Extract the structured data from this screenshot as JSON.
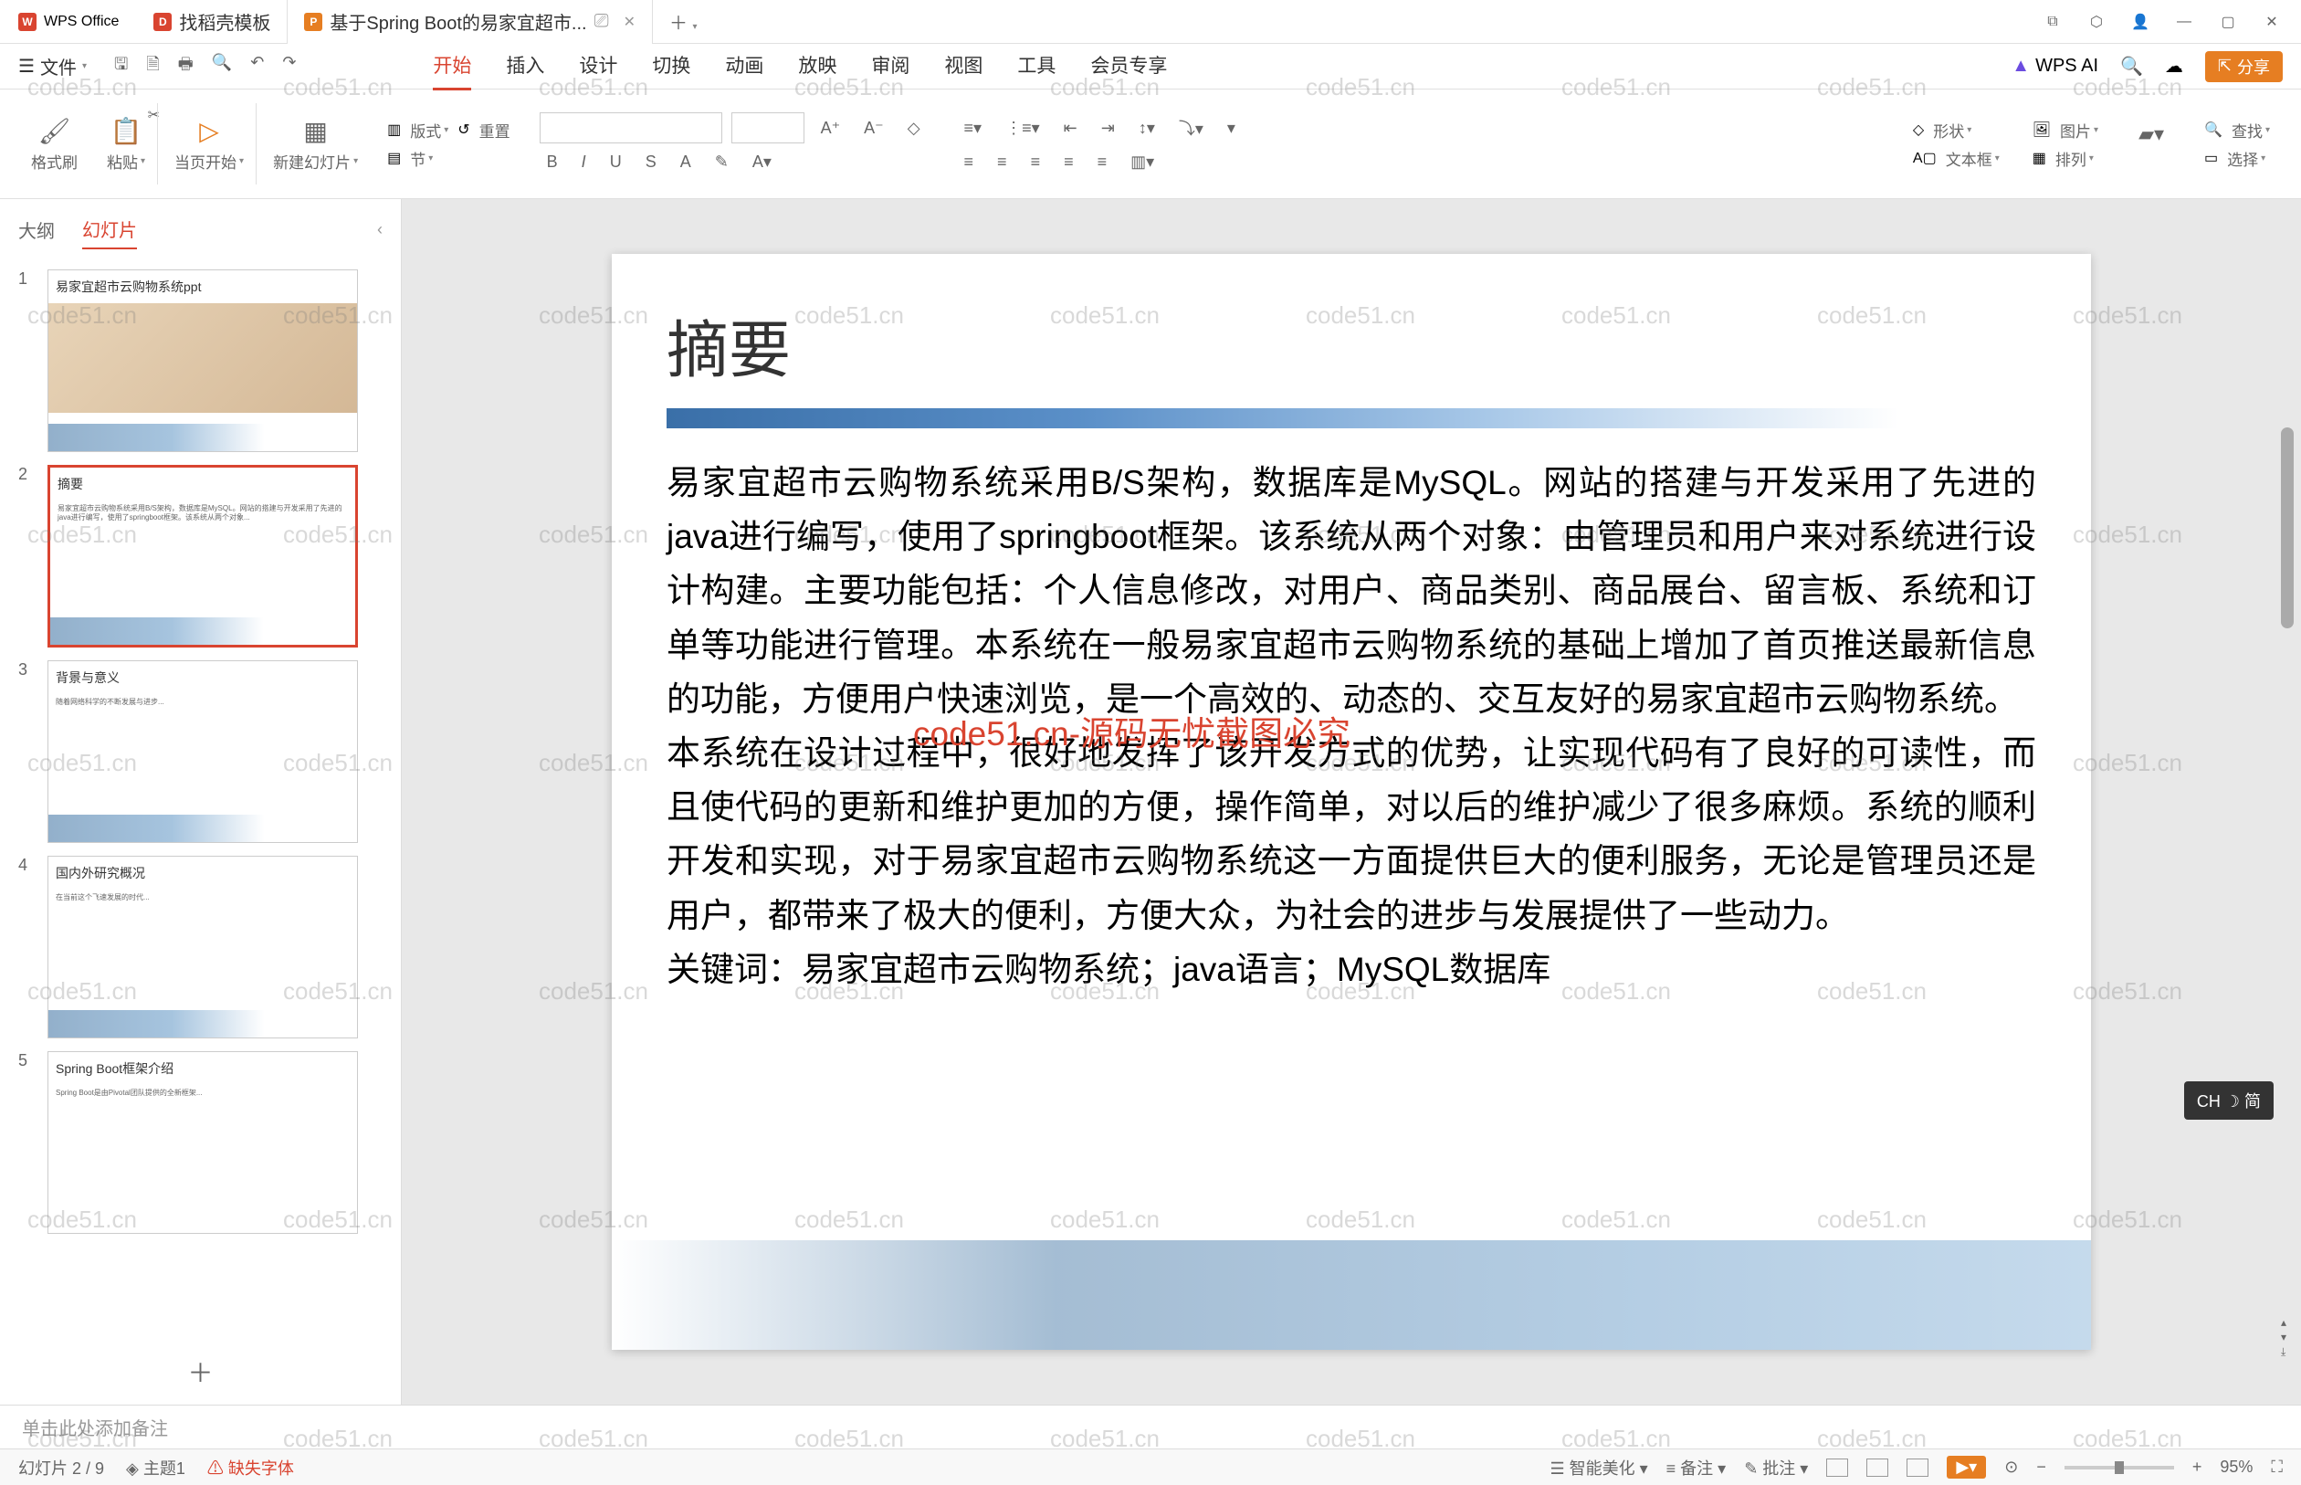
{
  "app": {
    "name": "WPS Office"
  },
  "tabs": [
    {
      "label": "找稻壳模板",
      "icon_color": "red"
    },
    {
      "label": "基于Spring Boot的易家宜超市...",
      "icon_color": "orange",
      "active": true
    }
  ],
  "file_menu": "文件",
  "menu": {
    "items": [
      "开始",
      "插入",
      "设计",
      "切换",
      "动画",
      "放映",
      "审阅",
      "视图",
      "工具",
      "会员专享"
    ],
    "active": "开始",
    "wps_ai": "WPS AI",
    "share": "分享"
  },
  "ribbon": {
    "format_brush": "格式刷",
    "paste": "粘贴",
    "current_start": "当页开始",
    "new_slide": "新建幻灯片",
    "layout": "版式",
    "section": "节",
    "reset": "重置",
    "shape": "形状",
    "image": "图片",
    "textbox": "文本框",
    "arrange": "排列",
    "find": "查找",
    "select": "选择",
    "font_letters": [
      "B",
      "I",
      "U",
      "S",
      "A"
    ]
  },
  "sidebar": {
    "outline": "大纲",
    "slides": "幻灯片",
    "items": [
      {
        "num": "1",
        "title": "易家宜超市云购物系统ppt"
      },
      {
        "num": "2",
        "title": "摘要"
      },
      {
        "num": "3",
        "title": "背景与意义"
      },
      {
        "num": "4",
        "title": "国内外研究概况"
      },
      {
        "num": "5",
        "title": "Spring Boot框架介绍"
      }
    ]
  },
  "slide": {
    "title": "摘要",
    "para1": "易家宜超市云购物系统采用B/S架构，数据库是MySQL。网站的搭建与开发采用了先进的java进行编写，使用了springboot框架。该系统从两个对象：由管理员和用户来对系统进行设计构建。主要功能包括：个人信息修改，对用户、商品类别、商品展台、留言板、系统和订单等功能进行管理。本系统在一般易家宜超市云购物系统的基础上增加了首页推送最新信息的功能，方便用户快速浏览，是一个高效的、动态的、交互友好的易家宜超市云购物系统。",
    "para2": "本系统在设计过程中，很好地发挥了该开发方式的优势，让实现代码有了良好的可读性，而且使代码的更新和维护更加的方便，操作简单，对以后的维护减少了很多麻烦。系统的顺利开发和实现，对于易家宜超市云购物系统这一方面提供巨大的便利服务，无论是管理员还是用户，都带来了极大的便利，方便大众，为社会的进步与发展提供了一些动力。",
    "para3": "关键词：易家宜超市云购物系统；java语言；MySQL数据库",
    "center_wm": "code51.cn-源码无忧截图必究"
  },
  "notes": {
    "placeholder": "单击此处添加备注"
  },
  "status": {
    "slide_counter": "幻灯片 2 / 9",
    "theme": "主题1",
    "missing_font": "缺失字体",
    "smart_beautify": "智能美化",
    "notes_btn": "备注",
    "review": "批注",
    "zoom": "95%"
  },
  "watermark_text": "code51.cn",
  "ime": "CH ☽ 简"
}
